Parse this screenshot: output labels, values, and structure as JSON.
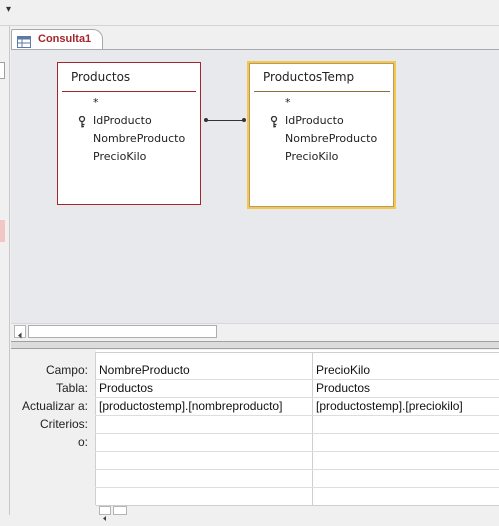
{
  "tab": {
    "label": "Consulta1"
  },
  "tables": [
    {
      "title": "Productos",
      "fields": [
        "*",
        "IdProducto",
        "NombreProducto",
        "PrecioKilo"
      ],
      "key_field_index": 1
    },
    {
      "title": "ProductosTemp",
      "fields": [
        "*",
        "IdProducto",
        "NombreProducto",
        "PrecioKilo"
      ],
      "key_field_index": 1
    }
  ],
  "grid": {
    "row_labels": [
      "Campo:",
      "Tabla:",
      "Actualizar a:",
      "Criterios:",
      "o:"
    ],
    "columns": [
      {
        "campo": "NombreProducto",
        "tabla": "Productos",
        "actualizar": "[productostemp].[nombreproducto]"
      },
      {
        "campo": "PrecioKilo",
        "tabla": "Productos",
        "actualizar": "[productostemp].[preciokilo]"
      }
    ]
  },
  "colors": {
    "tab_accent": "#a4262c",
    "selected_table_border": "#f5c84b"
  },
  "icons": {
    "quick_access": "dropdown-arrow-icon",
    "query": "query-icon",
    "primary_key": "key-icon"
  }
}
